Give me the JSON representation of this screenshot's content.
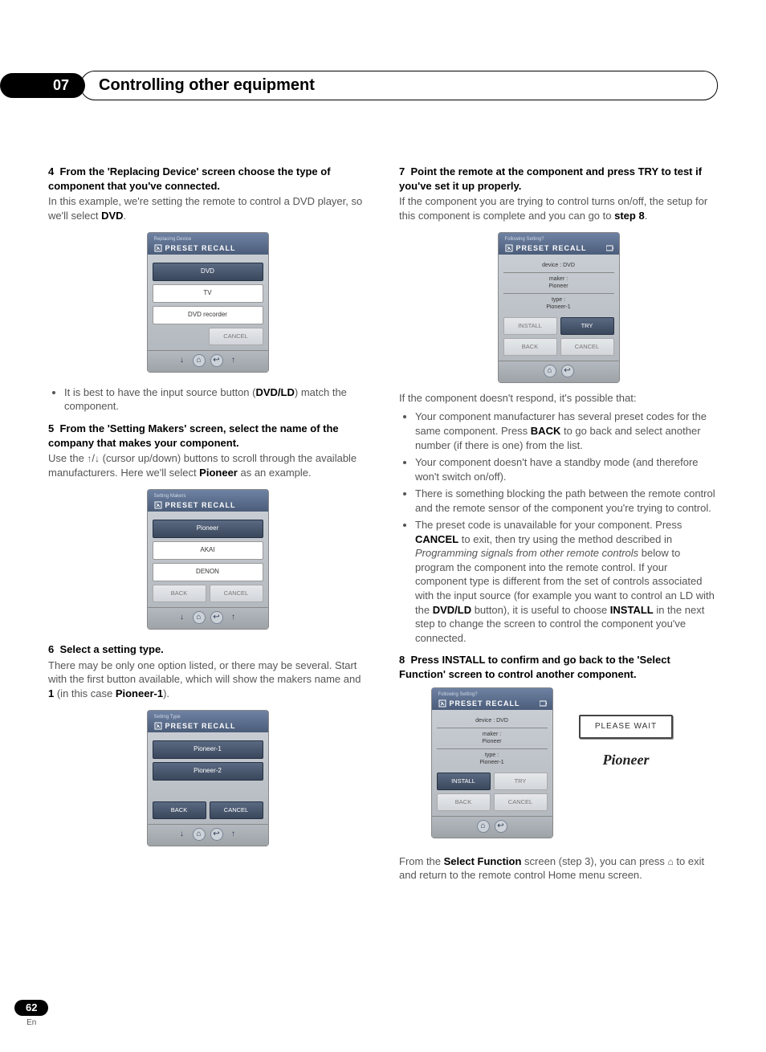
{
  "chapterNumber": "07",
  "chapterTitle": "Controlling other equipment",
  "pageNumber": "62",
  "langLabel": "En",
  "left": {
    "s4": {
      "num": "4",
      "head": "From the 'Replacing Device' screen choose the type of component that you've connected.",
      "body1": "In this example, we're setting the remote to control a DVD player, so we'll select ",
      "bold1": "DVD",
      "body2": ".",
      "bulletLead": "It is best to have the input source button (",
      "bulletBold": "DVD/LD",
      "bulletTail": ") match the component."
    },
    "s5": {
      "num": "5",
      "head": "From the 'Setting Makers' screen, select the name of the company that makes your component.",
      "body1": "Use the ",
      "body2": " (cursor up/down) buttons to scroll through the available manufacturers. Here we'll select ",
      "bold": "Pioneer",
      "body3": " as an example."
    },
    "s6": {
      "num": "6",
      "head": "Select a setting type.",
      "body1": "There may be only one option listed, or there may be several. Start with the first button available, which will show the makers name and ",
      "bold1": "1",
      "body2": " (in this case ",
      "bold2": "Pioneer-1",
      "body3": ")."
    }
  },
  "right": {
    "s7": {
      "num": "7",
      "head": "Point the remote at the component and press TRY to test if you've set it up properly.",
      "body1": "If the component you are trying to control turns on/off, the setup for this component is complete and you can go to ",
      "bold": "step 8",
      "body2": ".",
      "lead": "If the component doesn't respond, it's possible that:",
      "b1a": "Your component manufacturer has several preset codes for the same component. Press ",
      "b1bold": "BACK",
      "b1b": " to go back and select another number (if there is one) from the list.",
      "b2": "Your component doesn't have a standby mode (and therefore won't switch on/off).",
      "b3": "There is something blocking the path between the remote control and the remote sensor of the component you're trying to control.",
      "b4a": "The preset code is unavailable for your component. Press ",
      "b4bold1": "CANCEL",
      "b4b": " to exit, then try using the method described in ",
      "b4em": "Programming signals from other remote controls",
      "b4c": " below to program the component into the remote control. If your component type is different from the set of controls associated with the input source (for example you want to control an LD with the ",
      "b4bold2": "DVD/LD",
      "b4d": " button), it is useful to choose ",
      "b4bold3": "INSTALL",
      "b4e": " in the next step to change the screen to control the component you've connected."
    },
    "s8": {
      "num": "8",
      "head": "Press INSTALL to confirm and go back to the 'Select Function' screen to control another component.",
      "tail1": "From the ",
      "tailBold": "Select Function",
      "tail2": " screen (step 3), you can press ",
      "tail3": " to exit and return to the remote control Home menu screen."
    }
  },
  "screens": {
    "presetRecall": "PRESET RECALL",
    "a": {
      "title": "Replacing Device",
      "opt1": "DVD",
      "opt2": "TV",
      "opt3": "DVD recorder",
      "cancel": "CANCEL"
    },
    "b": {
      "title": "Setting Makers",
      "opt1": "Pioneer",
      "opt2": "AKAI",
      "opt3": "DENON",
      "back": "BACK",
      "cancel": "CANCEL"
    },
    "c": {
      "title": "Setting Type",
      "opt1": "Pioneer-1",
      "opt2": "Pioneer-2",
      "back": "BACK",
      "cancel": "CANCEL"
    },
    "d": {
      "title": "Following Setting?",
      "l1": "device : DVD",
      "l2a": "maker :",
      "l2b": "Pioneer",
      "l3a": "type :",
      "l3b": "Pioneer-1",
      "install": "INSTALL",
      "try": "TRY",
      "back": "BACK",
      "cancel": "CANCEL"
    },
    "wait": "PLEASE WAIT",
    "logo": "Pioneer"
  }
}
